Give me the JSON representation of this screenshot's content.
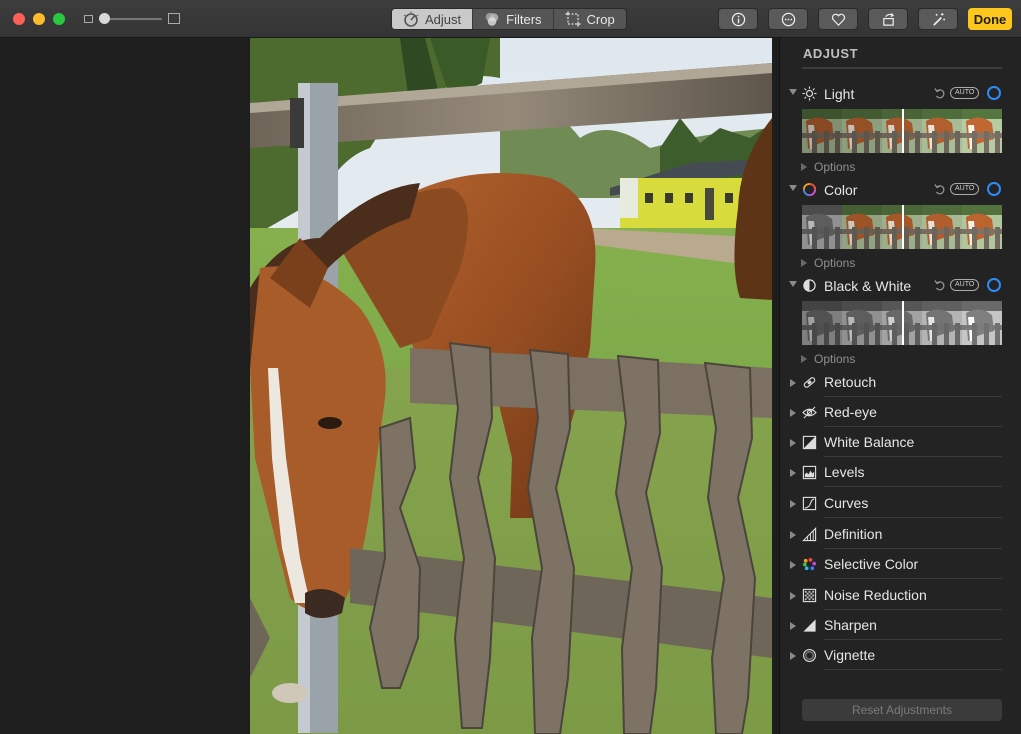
{
  "toolbar": {
    "tabs": [
      {
        "label": "Adjust",
        "icon": "adjust-dial-icon",
        "active": true
      },
      {
        "label": "Filters",
        "icon": "filters-circles-icon",
        "active": false
      },
      {
        "label": "Crop",
        "icon": "crop-icon",
        "active": false
      }
    ],
    "buttons": [
      "info-icon",
      "more-icon",
      "heart-icon",
      "rotate-icon",
      "magic-wand-icon"
    ],
    "done_label": "Done",
    "accent_color": "#fcc71d"
  },
  "sidebar": {
    "title": "ADJUST",
    "expanded": [
      {
        "label": "Light",
        "icon": "sun-icon",
        "auto": "AUTO",
        "options": "Options",
        "style": "color"
      },
      {
        "label": "Color",
        "icon": "color-wheel-icon",
        "auto": "AUTO",
        "options": "Options",
        "style": "mixed"
      },
      {
        "label": "Black & White",
        "icon": "half-circle-icon",
        "auto": "AUTO",
        "options": "Options",
        "style": "gray"
      }
    ],
    "collapsed": [
      {
        "label": "Retouch",
        "icon": "bandage-icon"
      },
      {
        "label": "Red-eye",
        "icon": "eye-icon"
      },
      {
        "label": "White Balance",
        "icon": "white-balance-icon"
      },
      {
        "label": "Levels",
        "icon": "levels-icon"
      },
      {
        "label": "Curves",
        "icon": "curves-icon"
      },
      {
        "label": "Definition",
        "icon": "definition-icon"
      },
      {
        "label": "Selective Color",
        "icon": "selective-color-icon"
      },
      {
        "label": "Noise Reduction",
        "icon": "noise-icon"
      },
      {
        "label": "Sharpen",
        "icon": "sharpen-icon"
      },
      {
        "label": "Vignette",
        "icon": "vignette-icon"
      }
    ],
    "reset_label": "Reset Adjustments",
    "toggle_color": "#2d8df6"
  }
}
